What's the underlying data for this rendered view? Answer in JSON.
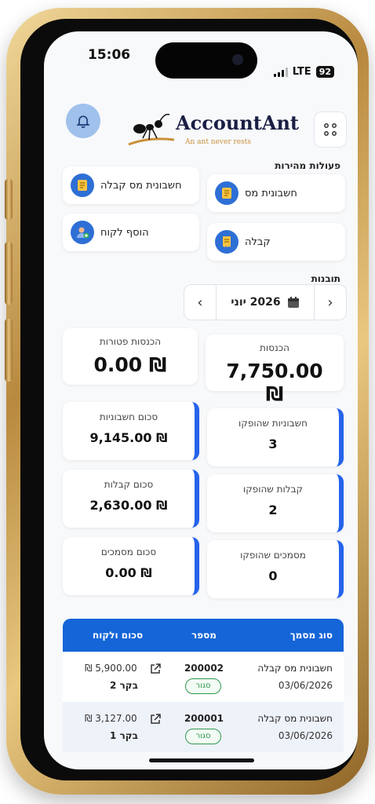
{
  "status": {
    "time": "15:06",
    "network": "LTE",
    "battery": "92"
  },
  "header": {
    "logo_text": "AccountAnt",
    "logo_tagline": "An ant never rests",
    "bell_icon": "bell-icon",
    "menu_icon": "grid-icon"
  },
  "quick_actions": {
    "title": "פעולות מהירות",
    "items": [
      {
        "label": "חשבונית מס",
        "icon": "document-icon"
      },
      {
        "label": "חשבונית מס קבלה",
        "icon": "document-icon"
      },
      {
        "label": "קבלה",
        "icon": "receipt-icon"
      },
      {
        "label": "הוסף לקוח",
        "icon": "add-user-icon"
      }
    ]
  },
  "insights": {
    "title": "תובנות",
    "month": "2026 יוני",
    "prev_symbol": "‹",
    "next_symbol": "›"
  },
  "summary": {
    "income_label": "הכנסות",
    "income_value": "7,750.00 ₪",
    "exempt_label": "הכנסות פטורות",
    "exempt_value": "0.00 ₪"
  },
  "stats": {
    "invoices_issued_label": "חשבוניות שהופקו",
    "invoices_issued_value": "3",
    "invoices_total_label": "סכום חשבוניות",
    "invoices_total_value": "9,145.00 ₪",
    "receipts_issued_label": "קבלות שהופקו",
    "receipts_issued_value": "2",
    "receipts_total_label": "סכום קבלות",
    "receipts_total_value": "2,630.00 ₪",
    "docs_issued_label": "מסמכים שהופקו",
    "docs_issued_value": "0",
    "docs_total_label": "סכום מסמכים",
    "docs_total_value": "0.00 ₪"
  },
  "table": {
    "columns": [
      "סוג מסמך",
      "מספר",
      "סכום ולקוח"
    ],
    "rows": [
      {
        "type": "חשבונית מס קבלה",
        "date": "03/06/2026",
        "number": "200002",
        "status": "סגור",
        "amount": "₪ 5,900.00",
        "client": "בקר 2"
      },
      {
        "type": "חשבונית מס קבלה",
        "date": "03/06/2026",
        "number": "200001",
        "status": "סגור",
        "amount": "₪ 3,127.00",
        "client": "בקר 1"
      }
    ]
  },
  "colors": {
    "accent": "#2563eb",
    "header_blue": "#1565d8",
    "status_green": "#2e9a4f",
    "frame_gold": "#c49a4a"
  }
}
